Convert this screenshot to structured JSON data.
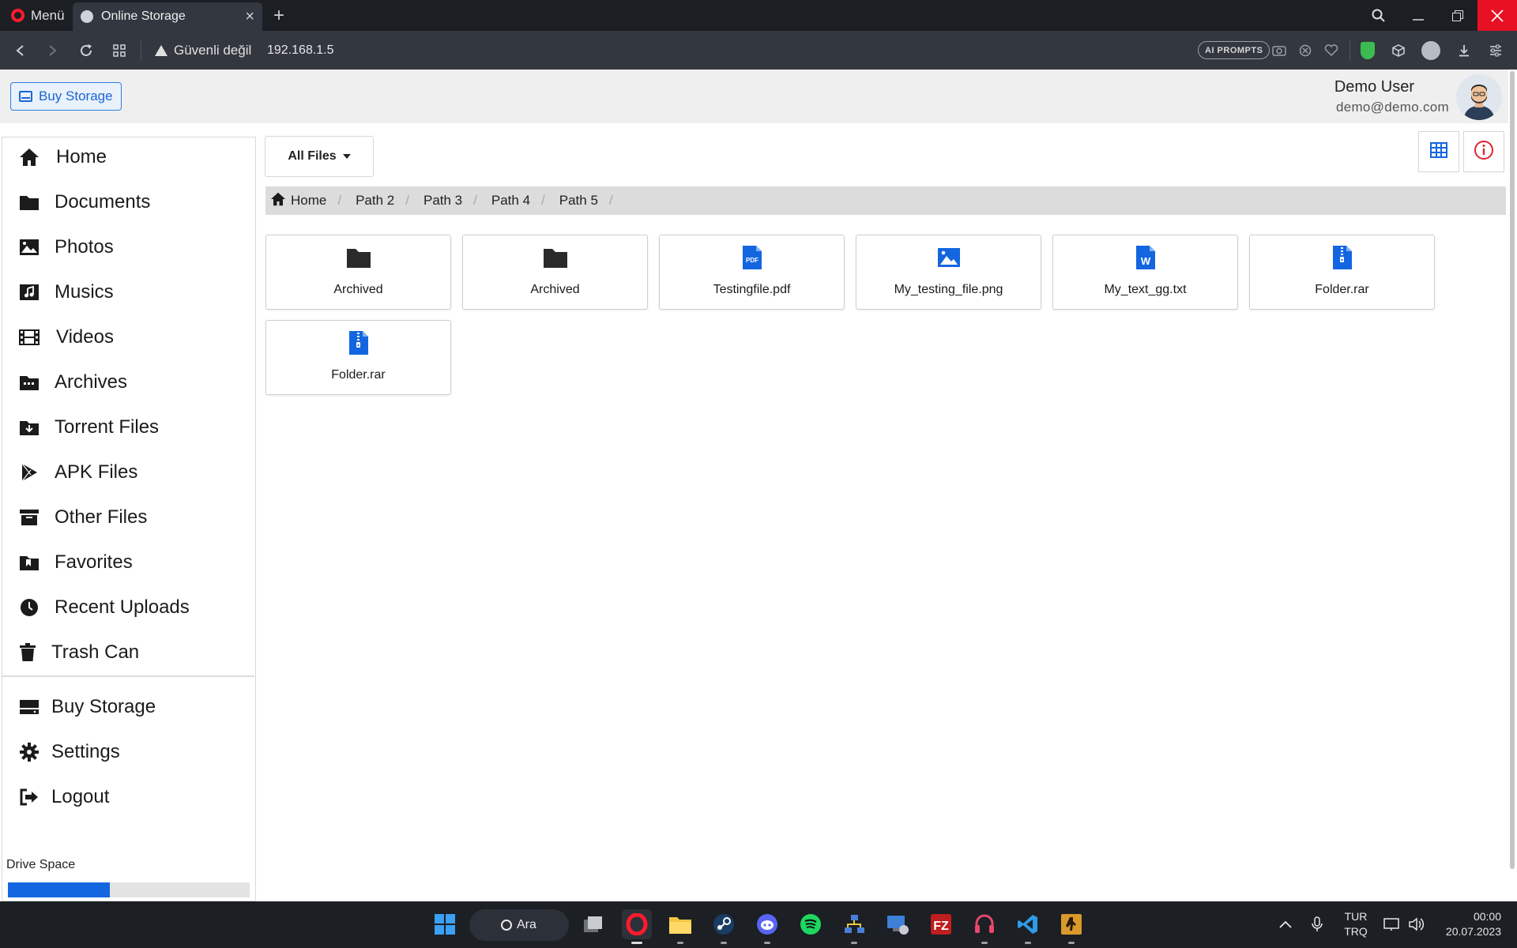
{
  "browser": {
    "menu_label": "Menü",
    "tab_title": "Online Storage",
    "security_label": "Güvenli değil",
    "url": "192.168.1.5",
    "ai_prompts_label": "AI PROMPTS"
  },
  "header": {
    "buy_storage_label": "Buy Storage",
    "user_name": "Demo User",
    "user_email": "demo@demo.com"
  },
  "sidebar": {
    "items": [
      {
        "label": "Home",
        "icon": "home-icon"
      },
      {
        "label": "Documents",
        "icon": "folder-icon"
      },
      {
        "label": "Photos",
        "icon": "image-icon"
      },
      {
        "label": "Musics",
        "icon": "music-icon"
      },
      {
        "label": "Videos",
        "icon": "film-icon"
      },
      {
        "label": "Archives",
        "icon": "archive-folder-icon"
      },
      {
        "label": "Torrent Files",
        "icon": "download-file-icon"
      },
      {
        "label": "APK Files",
        "icon": "play-store-icon"
      },
      {
        "label": "Other Files",
        "icon": "box-icon"
      },
      {
        "label": "Favorites",
        "icon": "bookmark-icon"
      },
      {
        "label": "Recent Uploads",
        "icon": "clock-icon"
      },
      {
        "label": "Trash Can",
        "icon": "trash-icon"
      }
    ],
    "bottom_items": [
      {
        "label": "Buy Storage",
        "icon": "hdd-icon"
      },
      {
        "label": "Settings",
        "icon": "gear-icon"
      },
      {
        "label": "Logout",
        "icon": "logout-icon"
      }
    ],
    "drive_space_label": "Drive Space",
    "drive_space_used_fraction": 0.42
  },
  "toolbar": {
    "filter_label": "All Files"
  },
  "breadcrumb": [
    "Home",
    "Path 2",
    "Path 3",
    "Path 4",
    "Path 5"
  ],
  "files": [
    {
      "name": "Archived",
      "type": "folder"
    },
    {
      "name": "Archived",
      "type": "folder"
    },
    {
      "name": "Testingfile.pdf",
      "type": "pdf"
    },
    {
      "name": "My_testing_file.png",
      "type": "image"
    },
    {
      "name": "My_text_gg.txt",
      "type": "word"
    },
    {
      "name": "Folder.rar",
      "type": "zip"
    },
    {
      "name": "Folder.rar",
      "type": "zip"
    }
  ],
  "taskbar": {
    "search_label": "Ara",
    "lang_top": "TUR",
    "lang_bottom": "TRQ",
    "time": "00:00",
    "date": "20.07.2023"
  },
  "colors": {
    "accent": "#1466e0",
    "info": "#e0242f",
    "close": "#e81123"
  }
}
